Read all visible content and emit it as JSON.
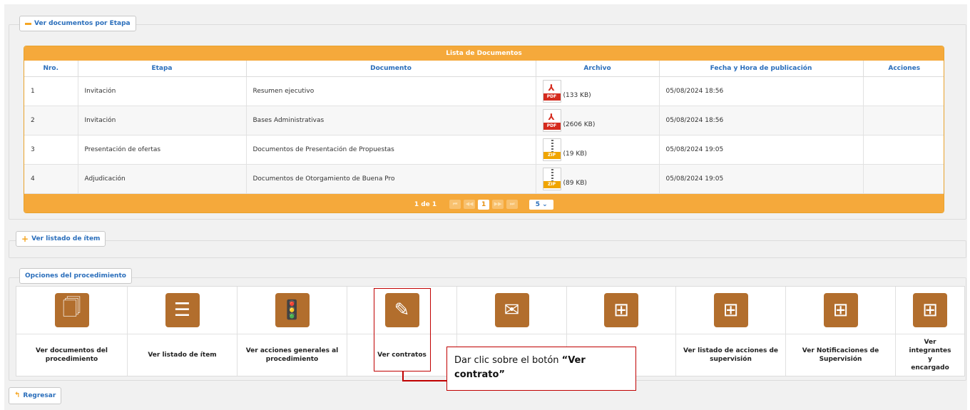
{
  "docs_section": {
    "toggle_label": "Ver documentos por Etapa",
    "table_title": "Lista de Documentos",
    "columns": [
      "Nro.",
      "Etapa",
      "Documento",
      "Archivo",
      "Fecha y Hora de publicación",
      "Acciones"
    ],
    "rows": [
      {
        "nro": "1",
        "etapa": "Invitación",
        "documento": "Resumen ejecutivo",
        "file_type": "PDF",
        "size": "(133 KB)",
        "fecha": "05/08/2024 18:56",
        "acciones": ""
      },
      {
        "nro": "2",
        "etapa": "Invitación",
        "documento": "Bases Administrativas",
        "file_type": "PDF",
        "size": "(2606 KB)",
        "fecha": "05/08/2024 18:56",
        "acciones": ""
      },
      {
        "nro": "3",
        "etapa": "Presentación de ofertas",
        "documento": "Documentos de Presentación de Propuestas",
        "file_type": "ZIP",
        "size": "(19 KB)",
        "fecha": "05/08/2024 19:05",
        "acciones": ""
      },
      {
        "nro": "4",
        "etapa": "Adjudicación",
        "documento": "Documentos de Otorgamiento de Buena Pro",
        "file_type": "ZIP",
        "size": "(89 KB)",
        "fecha": "05/08/2024 19:05",
        "acciones": ""
      }
    ],
    "pager": {
      "summary": "1 de 1",
      "current_page": "1",
      "page_size": "5"
    }
  },
  "items_section": {
    "toggle_label": "Ver listado de ítem"
  },
  "options_section": {
    "title": "Opciones del procedimiento",
    "options": [
      {
        "label": "Ver documentos del procedimiento",
        "icon": "documents-clock-icon"
      },
      {
        "label": "Ver listado de ítem",
        "icon": "numbered-list-icon"
      },
      {
        "label": "Ver acciones generales al procedimiento",
        "icon": "traffic-light-icon"
      },
      {
        "label": "Ver contratos",
        "icon": "contract-pen-icon"
      },
      {
        "label": "",
        "icon": "document-mail-icon"
      },
      {
        "label": "de nes",
        "icon": "hierarchy-icon"
      },
      {
        "label": "Ver listado de acciones de supervisión",
        "icon": "hierarchy-icon"
      },
      {
        "label": "Ver Notificaciones de Supervisión",
        "icon": "hierarchy-icon"
      },
      {
        "label": "Ver integrantes y encargado",
        "icon": "hierarchy-icon"
      }
    ]
  },
  "callout": {
    "text_prefix": "Dar clic sobre el botón ",
    "text_bold": "“Ver contrato”"
  },
  "back_button": {
    "label": "Regresar"
  },
  "colors": {
    "accent_orange": "#f5a93b",
    "icon_brown": "#b26e2d",
    "link_blue": "#2a6ebb",
    "highlight_red": "#c00000"
  }
}
